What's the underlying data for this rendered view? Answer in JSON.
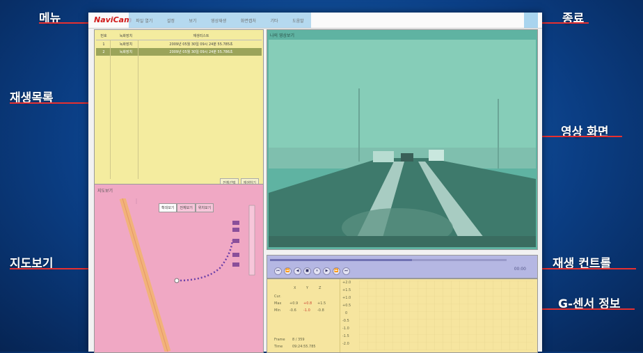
{
  "callouts": {
    "menu": "메뉴",
    "exit": "종료",
    "playlist": "재생목록",
    "video": "영상 화면",
    "map": "지도보기",
    "controls": "재생 컨트롤",
    "gsensor": "G-센서 정보"
  },
  "app": {
    "logo": "NaviCam",
    "menu_items": [
      "파일 열기",
      "설정",
      "보기",
      "영상재생",
      "화면캡처",
      "기타",
      "도움말"
    ]
  },
  "playlist": {
    "columns": [
      "번호",
      "녹화장치",
      "재생리스트"
    ],
    "rows": [
      {
        "no": "1",
        "device": "녹화장치",
        "name": "2009년 05월 30일 09시 24분 55.785초",
        "selected": false
      },
      {
        "no": "2",
        "device": "녹화장치",
        "name": "2009년 05월 30일 09시 24분 55.786초",
        "selected": true
      }
    ],
    "buttons": [
      "전체선택",
      "재생하기"
    ]
  },
  "map": {
    "title": "지도보기",
    "tabs": [
      "확대보기",
      "전체보기",
      "위치보기"
    ],
    "active_tab": 0
  },
  "video": {
    "title": "나의 영상보기"
  },
  "controls": {
    "buttons": [
      "⏮",
      "⏪",
      "◀",
      "■",
      "⏸",
      "▶",
      "⏩",
      "⏭"
    ],
    "progress": 0.6,
    "time": "00:00"
  },
  "gsensor": {
    "axes": [
      "X",
      "Y",
      "Z"
    ],
    "rows": [
      {
        "label": "Cur.",
        "values": [
          "",
          "",
          ""
        ]
      },
      {
        "label": "Max",
        "values": [
          "+0.9",
          "+0.8",
          "+1.5"
        ]
      },
      {
        "label": "Min",
        "values": [
          "-0.6",
          "-1.0",
          "-0.8"
        ]
      }
    ],
    "frame_label": "Frame",
    "frame_value": "8 / 359",
    "time_label": "Time",
    "time_value": "09:24:55.785",
    "scale": [
      "+2.0",
      "+1.5",
      "+1.0",
      "+0.5",
      "0",
      "-0.5",
      "-1.0",
      "-1.5",
      "-2.0"
    ]
  },
  "colors": {
    "accent": "#e8302f",
    "playlist_bg": "#f4ec9f",
    "map_bg": "#f0a8c4",
    "video_bg": "#5fb3a2",
    "controls_bg": "#b5b7e3",
    "gsensor_bg": "#f6e59f"
  }
}
